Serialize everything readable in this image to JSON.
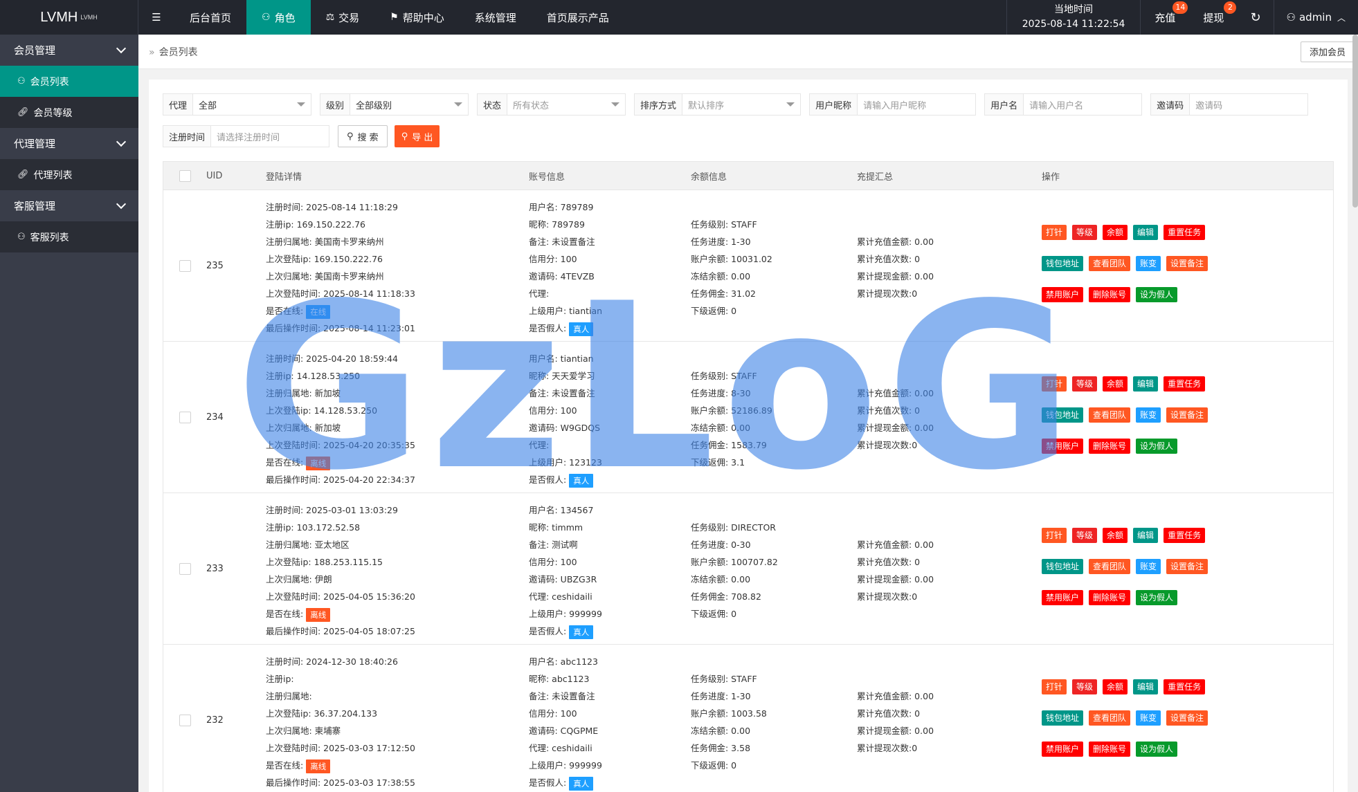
{
  "app": {
    "logo": "LVMH",
    "logo_sup": "LVMH"
  },
  "topnav": {
    "menu_icon": "menu-icon",
    "items": [
      {
        "label": "后台首页",
        "icon": ""
      },
      {
        "label": "角色",
        "icon": "user-icon",
        "active": true
      },
      {
        "label": "交易",
        "icon": "scale-icon"
      },
      {
        "label": "帮助中心",
        "icon": "flag-icon"
      },
      {
        "label": "系统管理",
        "icon": ""
      },
      {
        "label": "首页展示产品",
        "icon": ""
      }
    ],
    "clock_label": "当地时间",
    "clock_value": "2025-08-14 11:22:54",
    "recharge": "充值",
    "recharge_badge": "14",
    "withdraw": "提现",
    "withdraw_badge": "2",
    "user": "admin"
  },
  "sidebar": {
    "groups": [
      {
        "label": "会员管理",
        "items": [
          {
            "label": "会员列表",
            "icon": "user-icon",
            "active": true
          },
          {
            "label": "会员等级",
            "icon": "link-icon"
          }
        ]
      },
      {
        "label": "代理管理",
        "items": [
          {
            "label": "代理列表",
            "icon": "link-icon"
          }
        ]
      },
      {
        "label": "客服管理",
        "items": [
          {
            "label": "客服列表",
            "icon": "users-icon"
          }
        ]
      }
    ]
  },
  "breadcrumb": {
    "label": "会员列表",
    "add_button": "添加会员"
  },
  "filters": {
    "agent": {
      "label": "代理",
      "value": "全部"
    },
    "level": {
      "label": "级别",
      "value": "全部级别"
    },
    "status": {
      "label": "状态",
      "placeholder": "所有状态"
    },
    "sort": {
      "label": "排序方式",
      "placeholder": "默认排序"
    },
    "nickname": {
      "label": "用户昵称",
      "placeholder": "请输入用户昵称"
    },
    "username": {
      "label": "用户名",
      "placeholder": "请输入用户名"
    },
    "invite": {
      "label": "邀请码",
      "placeholder": "邀请码"
    },
    "regtime": {
      "label": "注册时间",
      "placeholder": "请选择注册时间"
    },
    "search_button": "搜 索",
    "export_button": "导 出"
  },
  "table": {
    "headers": [
      "UID",
      "登陆详情",
      "账号信息",
      "余额信息",
      "充提汇总",
      "操作"
    ],
    "op_buttons": [
      [
        "打针",
        "等级",
        "余额",
        "编辑",
        "重置任务"
      ],
      [
        "钱包地址",
        "查看团队",
        "账变",
        "设置备注"
      ],
      [
        "禁用账户",
        "删除账号",
        "设为假人"
      ]
    ],
    "rows": [
      {
        "uid": "235",
        "login": [
          "注册时间:  2025-08-14 11:18:29",
          "注册ip: 169.150.222.76",
          "注册归属地: 美国南卡罗来纳州",
          "上次登陆ip: 169.150.222.76",
          "上次归属地: 美国南卡罗来纳州",
          "上次登陆时间: 2025-08-14 11:18:33"
        ],
        "online_label": "是否在线:",
        "online": "在线",
        "online_color": "blue",
        "last_op": "最后操作时间: 2025-08-14 11:23:01",
        "acct": [
          "用户名: 789789",
          "昵称: 789789",
          "备注: 未设置备注",
          "信用分: 100",
          "邀请码: 4TEVZB",
          "代理:",
          "上级用户: tiantian"
        ],
        "fake_label": "是否假人:",
        "fake": "真人",
        "bal": [
          "任务级别: STAFF",
          "任务进度: 1-30",
          "账户余额: 10031.02",
          "冻结余额: 0.00",
          "任务佣金: 31.02",
          "下级返佣: 0"
        ],
        "rec": [
          "累计充值金额: 0.00",
          "累计充值次数: 0",
          "累计提现金额: 0.00",
          "累计提现次数:0"
        ]
      },
      {
        "uid": "234",
        "login": [
          "注册时间:  2025-04-20 18:59:44",
          "注册ip: 14.128.53.250",
          "注册归属地: 新加坡",
          "上次登陆ip: 14.128.53.250",
          "上次归属地: 新加坡",
          "上次登陆时间: 2025-04-20 20:35:35"
        ],
        "online_label": "是否在线:",
        "online": "离线",
        "online_color": "orange",
        "last_op": "最后操作时间: 2025-04-20 22:34:37",
        "acct": [
          "用户名: tiantian",
          "昵称: 天天爱学习",
          "备注: 未设置备注",
          "信用分: 100",
          "邀请码: W9GDQS",
          "代理:",
          "上级用户: 123123"
        ],
        "fake_label": "是否假人:",
        "fake": "真人",
        "bal": [
          "任务级别: STAFF",
          "任务进度: 8-30",
          "账户余额: 52186.89",
          "冻结余额: 0.00",
          "任务佣金: 1583.79",
          "下级返佣: 3.1"
        ],
        "rec": [
          "累计充值金额: 0.00",
          "累计充值次数: 0",
          "累计提现金额: 0.00",
          "累计提现次数:0"
        ]
      },
      {
        "uid": "233",
        "login": [
          "注册时间:  2025-03-01 13:03:29",
          "注册ip: 103.172.52.58",
          "注册归属地: 亚太地区",
          "上次登陆ip: 188.253.115.15",
          "上次归属地: 伊朗",
          "上次登陆时间: 2025-04-05 15:36:20"
        ],
        "online_label": "是否在线:",
        "online": "离线",
        "online_color": "orange",
        "last_op": "最后操作时间: 2025-04-05 18:07:25",
        "acct": [
          "用户名: 134567",
          "昵称: timmm",
          "备注: 测试啊",
          "信用分: 100",
          "邀请码: UBZG3R",
          "代理: ceshidaili",
          "上级用户: 999999"
        ],
        "fake_label": "是否假人:",
        "fake": "真人",
        "bal": [
          "任务级别: DIRECTOR",
          "任务进度: 0-30",
          "账户余额: 100707.82",
          "冻结余额: 0.00",
          "任务佣金: 708.82",
          "下级返佣: 0"
        ],
        "rec": [
          "累计充值金额: 0.00",
          "累计充值次数: 0",
          "累计提现金额: 0.00",
          "累计提现次数:0"
        ]
      },
      {
        "uid": "232",
        "login": [
          "注册时间:  2024-12-30 18:40:26",
          "注册ip:",
          "注册归属地:",
          "上次登陆ip: 36.37.204.133",
          "上次归属地: 柬埔寨",
          "上次登陆时间: 2025-03-03 17:12:50"
        ],
        "online_label": "是否在线:",
        "online": "离线",
        "online_color": "orange",
        "last_op": "最后操作时间: 2025-03-03 17:38:55",
        "acct": [
          "用户名: abc1123",
          "昵称: abc1123",
          "备注: 未设置备注",
          "信用分: 100",
          "邀请码: CQGPME",
          "代理: ceshidaili",
          "上级用户: 999999"
        ],
        "fake_label": "是否假人:",
        "fake": "真人",
        "bal": [
          "任务级别: STAFF",
          "任务进度: 1-30",
          "账户余额: 1003.58",
          "冻结余额: 0.00",
          "任务佣金: 3.58",
          "下级返佣: 0"
        ],
        "rec": [
          "累计充值金额: 0.00",
          "累计充值次数: 0",
          "累计提现金额: 0.00",
          "累计提现次数:0"
        ]
      }
    ]
  },
  "watermark": "GzLoG",
  "colors": {
    "accent": "#009688",
    "topbar": "#23262e",
    "sidebar": "#393d49",
    "orange": "#ff5722",
    "blue": "#1e9fff"
  }
}
